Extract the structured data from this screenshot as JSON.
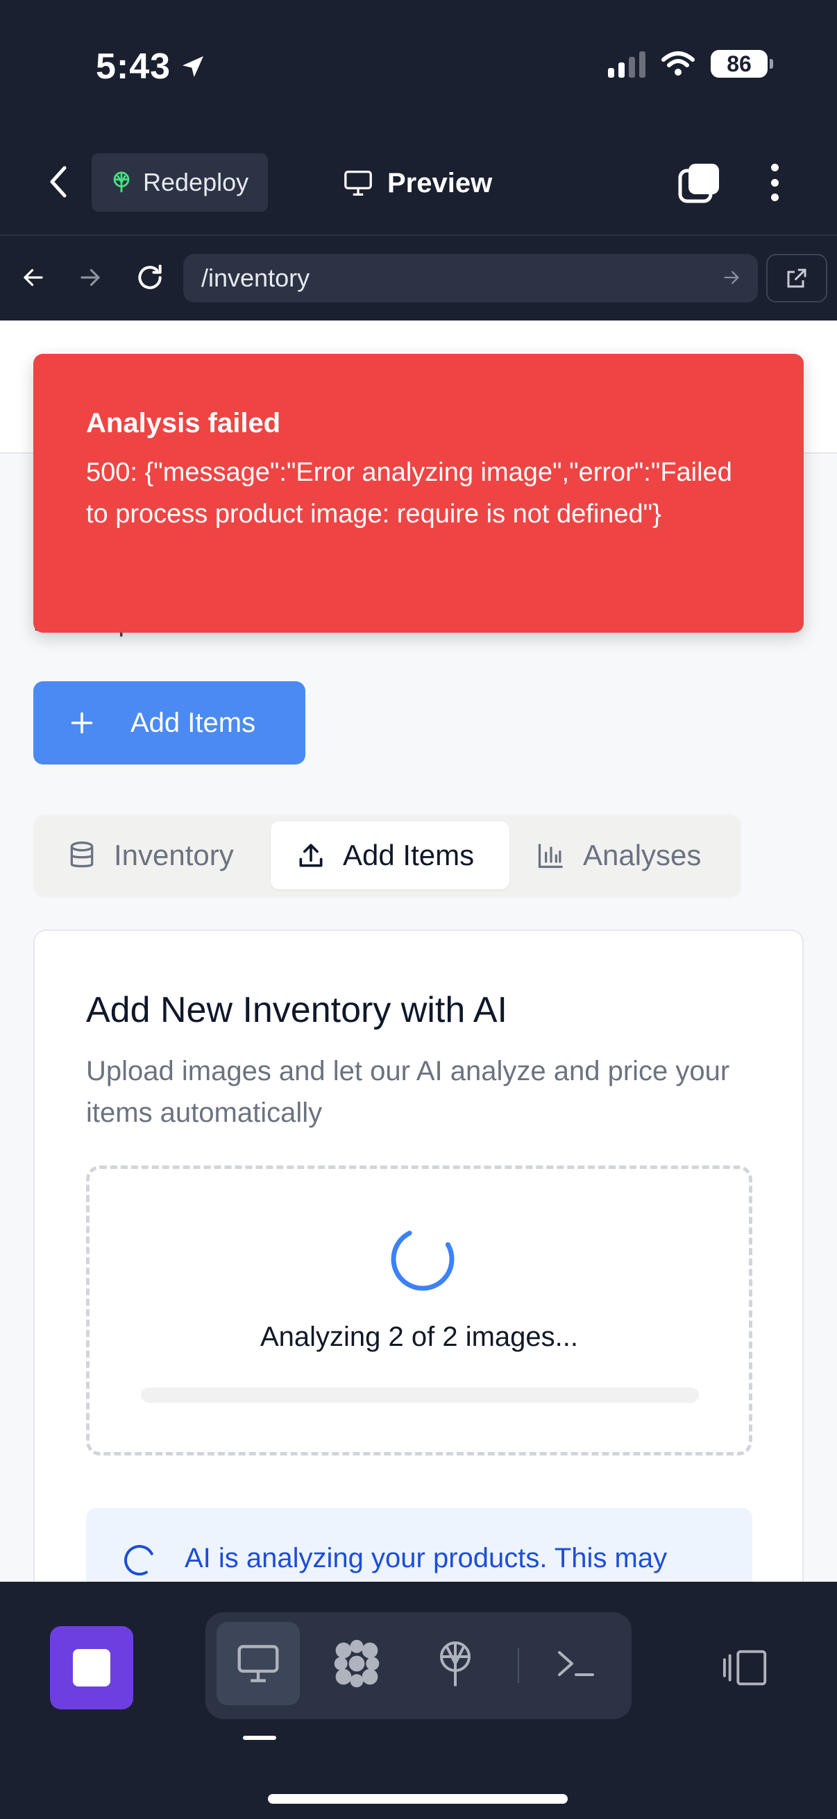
{
  "status_bar": {
    "time": "5:43",
    "battery": "86"
  },
  "header": {
    "redeploy_label": "Redeploy",
    "preview_label": "Preview"
  },
  "url_bar": {
    "url": "/inventory"
  },
  "toast": {
    "title": "Analysis failed",
    "message": "500: {\"message\":\"Error analyzing image\",\"error\":\"Failed to process product image: require is not defined\"}"
  },
  "page": {
    "hidden_subtitle_fragment": "marketplaces",
    "add_items_button": "Add Items",
    "tabs": [
      {
        "label": "Inventory",
        "icon": "database-icon",
        "active": false
      },
      {
        "label": "Add Items",
        "icon": "upload-icon",
        "active": true
      },
      {
        "label": "Analyses",
        "icon": "bar-chart-icon",
        "active": false
      }
    ]
  },
  "card": {
    "title": "Add New Inventory with AI",
    "subtitle": "Upload images and let our AI analyze and price your items automatically",
    "analyzing_text": "Analyzing 2 of 2 images...",
    "progress_percent": 0,
    "info_text": "AI is analyzing your products. This may"
  },
  "bottom_toolbar": {
    "tools": [
      "monitor-icon",
      "puzzle-icon",
      "deploy-icon",
      "terminal-icon"
    ],
    "active_tool": "monitor-icon"
  },
  "colors": {
    "chrome_bg": "#1b2030",
    "toast_red": "#ef4444",
    "primary_blue": "#4b8af2",
    "stop_purple": "#6d3fe0",
    "info_blue_text": "#1d4ed8"
  }
}
